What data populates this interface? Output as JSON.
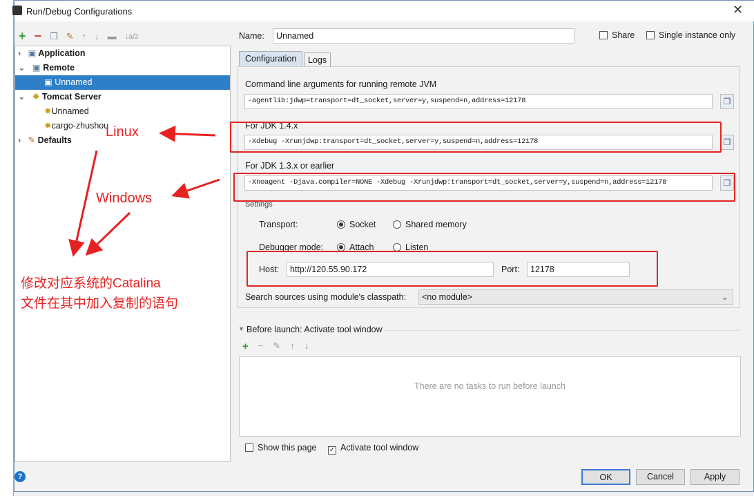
{
  "window": {
    "title": "Run/Debug Configurations"
  },
  "toolbar": {
    "add": "+",
    "remove": "−",
    "copy": "copy",
    "edit": "wrench",
    "up": "↑",
    "down": "↓",
    "folder": "folder",
    "sort": "↓a/z"
  },
  "tree": [
    {
      "label": "Application",
      "bold": true,
      "expanded": false
    },
    {
      "label": "Remote",
      "bold": true,
      "expanded": true
    },
    {
      "label": "Unnamed",
      "selected": true
    },
    {
      "label": "Tomcat Server",
      "bold": true,
      "expanded": true
    },
    {
      "label": "Unnamed"
    },
    {
      "label": "cargo-zhushou"
    },
    {
      "label": "Defaults",
      "bold": true,
      "expanded": false
    }
  ],
  "name": {
    "label": "Name:",
    "value": "Unnamed"
  },
  "share": {
    "label": "Share",
    "checked": false
  },
  "single_instance": {
    "label": "Single instance only",
    "checked": false
  },
  "tabs": [
    {
      "label": "Configuration",
      "active": true
    },
    {
      "label": "Logs",
      "active": false
    }
  ],
  "config": {
    "cmd_label": "Command line arguments for running remote JVM",
    "cmd_value": "-agentlib:jdwp=transport=dt_socket,server=y,suspend=n,address=12178",
    "jdk14_label": "For JDK 1.4.x",
    "jdk14_value": "-Xdebug -Xrunjdwp:transport=dt_socket,server=y,suspend=n,address=12178",
    "jdk13_label": "For JDK 1.3.x or earlier",
    "jdk13_value": "-Xnoagent -Djava.compiler=NONE -Xdebug -Xrunjdwp:transport=dt_socket,server=y,suspend=n,address=12178",
    "settings_label": "Settings",
    "transport_label": "Transport:",
    "transport_socket": "Socket",
    "transport_shared": "Shared memory",
    "debugger_label": "Debugger mode:",
    "debugger_attach": "Attach",
    "debugger_listen": "Listen",
    "host_label": "Host:",
    "host_value": "http://120.55.90.172",
    "port_label": "Port:",
    "port_value": "12178",
    "module_label": "Search sources using module's classpath:",
    "module_value": "<no module>"
  },
  "before_launch": {
    "label": "Before launch: Activate tool window",
    "empty": "There are no tasks to run before launch"
  },
  "footer": {
    "show_page": "Show this page",
    "activate_tool": "Activate tool window",
    "ok": "OK",
    "cancel": "Cancel",
    "apply": "Apply"
  },
  "annotations": {
    "linux": "Linux",
    "windows": "Windows",
    "note_line1": "修改对应系统的Catalina",
    "note_line2": "文件在其中加入复制的语句",
    "color": "#e52222"
  },
  "colors": {
    "selection": "#2f7fc8",
    "accent_green": "#3a9a3a"
  }
}
